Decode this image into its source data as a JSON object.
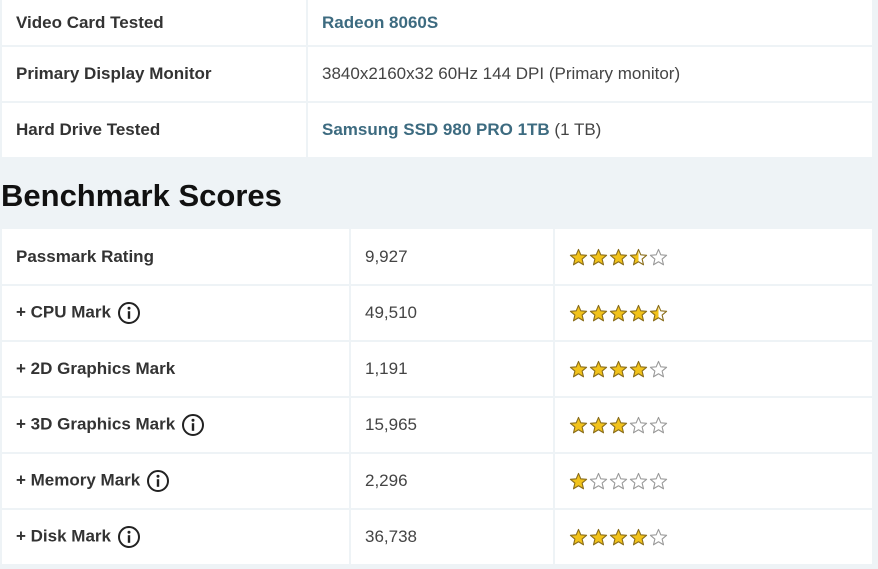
{
  "specs": {
    "rows": [
      {
        "label": "Video Card Tested",
        "link": "Radeon 8060S",
        "extra": ""
      },
      {
        "label": "Primary Display Monitor",
        "text": "3840x2160x32 60Hz 144 DPI (Primary monitor)"
      },
      {
        "label": "Hard Drive Tested",
        "link": "Samsung SSD 980 PRO 1TB",
        "extra": " (1 TB)"
      }
    ]
  },
  "benchmark": {
    "title": "Benchmark Scores",
    "rows": [
      {
        "name": "Passmark Rating",
        "score": "9,927",
        "rating": 3.5,
        "info": false
      },
      {
        "name": "+ CPU Mark",
        "score": "49,510",
        "rating": 4.5,
        "info": true
      },
      {
        "name": "+ 2D Graphics Mark",
        "score": "1,191",
        "rating": 4,
        "info": false
      },
      {
        "name": "+ 3D Graphics Mark",
        "score": "15,965",
        "rating": 3,
        "info": true
      },
      {
        "name": "+ Memory Mark",
        "score": "2,296",
        "rating": 1,
        "info": true
      },
      {
        "name": "+ Disk Mark",
        "score": "36,738",
        "rating": 4,
        "info": true
      }
    ],
    "max_rating": 5
  },
  "colors": {
    "link": "#3d6b80",
    "star_fill": "#f2c31b",
    "star_outline": "#8a6d1a",
    "empty_star_outline": "#9a9a9a"
  }
}
